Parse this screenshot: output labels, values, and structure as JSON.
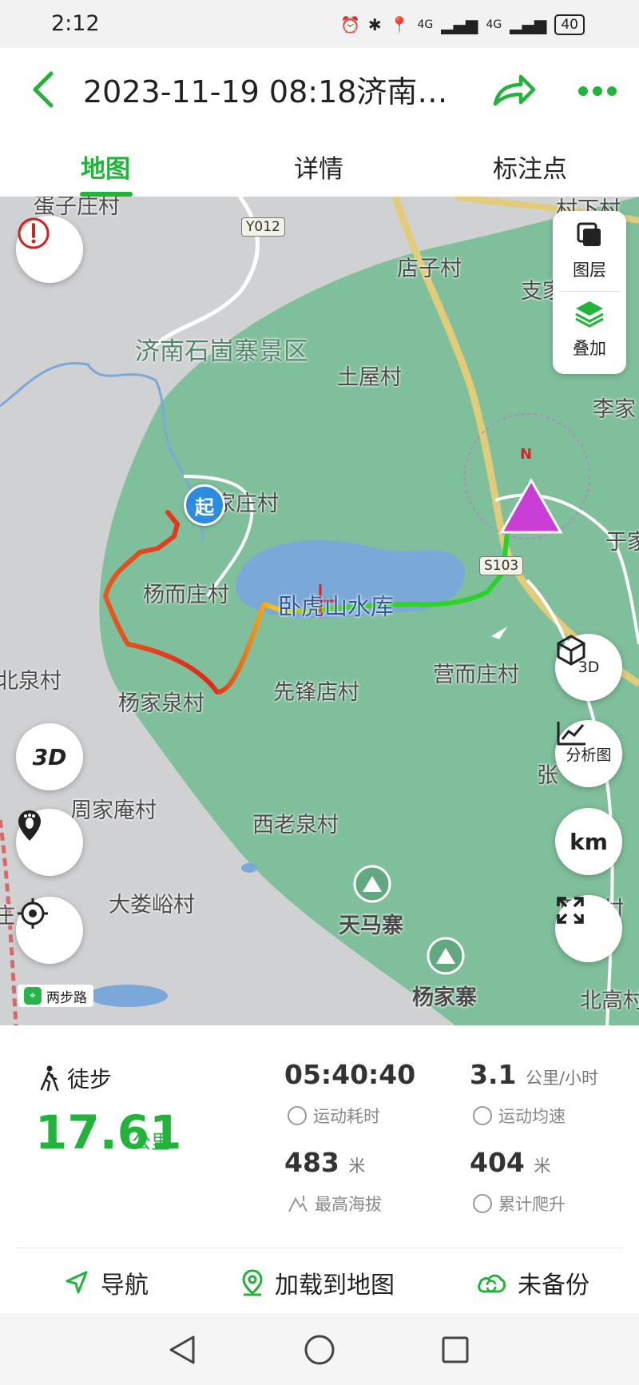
{
  "status_bar": {
    "time": "2:12",
    "network1": "4G",
    "network2": "4G",
    "battery": "40"
  },
  "header": {
    "title": "2023-11-19 08:18济南…"
  },
  "tabs": [
    {
      "label": "地图",
      "active": true
    },
    {
      "label": "详情",
      "active": false
    },
    {
      "label": "标注点",
      "active": false
    }
  ],
  "map": {
    "places": {
      "top_left": "蛋子庄村",
      "top_right": "村下村",
      "dianzi": "店子村",
      "zhi": "支家",
      "scenic": "济南石崮寨景区",
      "tuwu": "土屋村",
      "li": "李家",
      "zhuang": "家庄村",
      "yu": "于家",
      "yanger": "杨而庄村",
      "reservoir": "卧虎山水库",
      "beiquan": "北泉村",
      "yingr": "营而庄村",
      "yangjiaquan": "杨家泉村",
      "xianfeng": "先锋店村",
      "zhang": "张",
      "zhoujiaan": "周家庵村",
      "xilaoquan": "西老泉村",
      "dalouyu": "大娄峪村",
      "tianma": "天马寨",
      "zhuangr": "庄",
      "xi_right": "西庄村",
      "yangjiazhai": "杨家寨",
      "beigao": "北高村"
    },
    "road_tags": {
      "y012": "Y012",
      "s103": "S103"
    },
    "start_label": "起",
    "compass_north": "N",
    "buttons": {
      "layers": "图层",
      "overlay": "叠加",
      "three_d": "3D",
      "analysis": "分析图",
      "km": "km",
      "left_3d": "3D"
    },
    "brand": "两步路"
  },
  "stats": {
    "activity": "徒步",
    "distance": "17.61",
    "distance_unit": "公里",
    "duration": "05:40:40",
    "duration_label": "运动耗时",
    "avg_speed": "3.1",
    "avg_speed_unit": "公里/小时",
    "avg_speed_label": "运动均速",
    "max_altitude": "483",
    "max_altitude_unit": "米",
    "max_altitude_label": "最高海拔",
    "total_climb": "404",
    "total_climb_unit": "米",
    "total_climb_label": "累计爬升"
  },
  "actions": {
    "navigate": "导航",
    "load_to_map": "加载到地图",
    "not_backed_up": "未备份"
  },
  "colors": {
    "accent": "#22b33a",
    "map_green": "#7fbf9b",
    "map_gray": "#cfd1d3",
    "water": "#7aa8d8",
    "marker": "#c93fd6",
    "start_pin": "#2d8ce0"
  }
}
